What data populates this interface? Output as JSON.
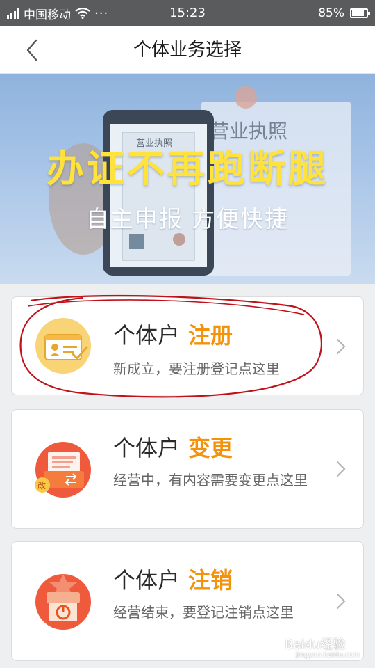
{
  "status_bar": {
    "carrier": "中国移动",
    "dots": "···",
    "time": "15:23",
    "battery": "85%",
    "battery_level": 0.85
  },
  "header": {
    "title": "个体业务选择"
  },
  "banner": {
    "headline": "办证不再跑断腿",
    "subline": "自主申报  方便快捷",
    "license_heading": "营业执照",
    "phone_screen_text": "营业执照"
  },
  "cards": [
    {
      "name": "个体户",
      "accent": "注册",
      "description": "新成立，要注册登记点这里",
      "icon": "license-card-icon"
    },
    {
      "name": "个体户",
      "accent": "变更",
      "description": "经营中，有内容需要变更点这里",
      "icon": "change-document-icon",
      "badge": "改"
    },
    {
      "name": "个体户",
      "accent": "注销",
      "description": "经营结束，要登记注销点这里",
      "icon": "shop-cancel-icon"
    }
  ],
  "watermark": {
    "text": "Baidu经验",
    "url": "jingyan.baidu.com"
  },
  "colors": {
    "accent": "#f3930c",
    "status_bar": "#5a5b5d",
    "annotation": "#c0121a",
    "banner_headline": "#ffe23a"
  }
}
